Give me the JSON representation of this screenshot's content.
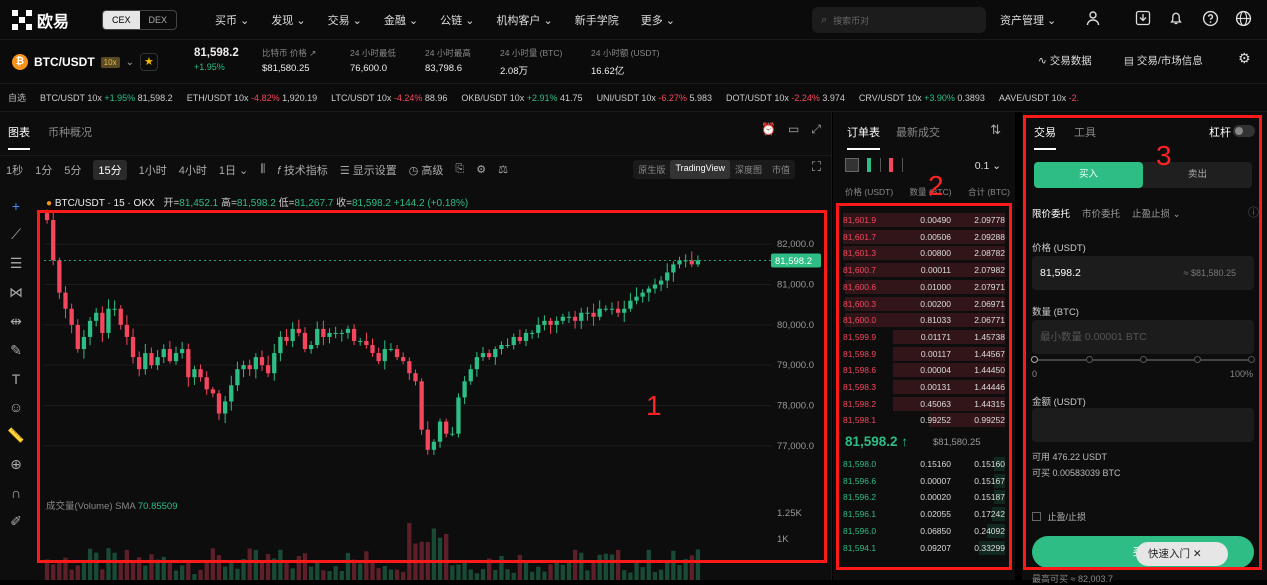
{
  "brand": {
    "name": "欧易"
  },
  "env_switch": {
    "cex": "CEX",
    "dex": "DEX"
  },
  "nav": [
    "买币 ⌄",
    "发现 ⌄",
    "交易 ⌄",
    "金融 ⌄",
    "公链 ⌄",
    "机构客户 ⌄",
    "新手学院",
    "更多 ⌄"
  ],
  "search": {
    "placeholder": "搜索币对"
  },
  "assets_label": "资产管理 ⌄",
  "ticker": {
    "pair": "BTC/USDT",
    "leverage": "10x",
    "last": "81,598.2",
    "change": "+1.95%",
    "index_label": "比特币 价格 ↗",
    "index_value": "$81,580.25",
    "low_label": "24 小时最低",
    "low_value": "76,600.0",
    "high_label": "24 小时最高",
    "high_value": "83,798.6",
    "vol_label": "24 小时量 (BTC)",
    "vol_value": "2.08万",
    "amt_label": "24 小时额 (USDT)",
    "amt_value": "16.62亿"
  },
  "right_tools": {
    "data": "交易数据",
    "info": "交易/市场信息"
  },
  "favorites": {
    "label": "自选",
    "items": [
      {
        "pair": "BTC/USDT 10x",
        "chg": "+1.95%",
        "price": "81,598.2",
        "dir": "up"
      },
      {
        "pair": "ETH/USDT 10x",
        "chg": "-4.82%",
        "price": "1,920.19",
        "dir": "dn"
      },
      {
        "pair": "LTC/USDT 10x",
        "chg": "-4.24%",
        "price": "88.96",
        "dir": "dn"
      },
      {
        "pair": "OKB/USDT 10x",
        "chg": "+2.91%",
        "price": "41.75",
        "dir": "up"
      },
      {
        "pair": "UNI/USDT 10x",
        "chg": "-6.27%",
        "price": "5.983",
        "dir": "dn"
      },
      {
        "pair": "DOT/USDT 10x",
        "chg": "-2.24%",
        "price": "3.974",
        "dir": "dn"
      },
      {
        "pair": "CRV/USDT 10x",
        "chg": "+3.90%",
        "price": "0.3893",
        "dir": "up"
      },
      {
        "pair": "AAVE/USDT 10x",
        "chg": "-2.",
        "price": "",
        "dir": "dn"
      }
    ]
  },
  "chart": {
    "tabs": [
      "图表",
      "币种概况"
    ],
    "intervals": [
      "1秒",
      "1分",
      "5分",
      "15分",
      "1小时",
      "4小时",
      "1日 ⌄"
    ],
    "active_interval": "15分",
    "indicators": "技术指标",
    "display": "显示设置",
    "advanced": "高级",
    "views": [
      "原生版",
      "TradingView",
      "深度图",
      "市值"
    ],
    "active_view": "TradingView",
    "ohlc_title": "BTC/USDT · 15 · OKX",
    "o_label": "开=",
    "o": "81,452.1",
    "h_label": "高=",
    "h": "81,598.2",
    "l_label": "低=",
    "l": "81,267.7",
    "c_label": "收=",
    "c": "81,598.2",
    "chg": "+144.2 (+0.18%)",
    "volume_label": "成交量(Volume)",
    "sma_label": "SMA",
    "sma_value": "70.85509",
    "price_ticks": [
      "82,000.0",
      "81,000.0",
      "80,000.0",
      "79,000.0",
      "78,000.0",
      "77,000.0"
    ],
    "current_price_tag": "81,598.2",
    "vol_ticks": [
      "1.25K",
      "1K"
    ]
  },
  "chart_data": {
    "type": "candlestick",
    "title": "BTC/USDT · 15 · OKX",
    "ylim": [
      76300,
      82800
    ],
    "closes": [
      82600,
      81600,
      80800,
      80400,
      80000,
      79400,
      79700,
      80100,
      80300,
      79800,
      80400,
      80400,
      80000,
      79700,
      79200,
      78900,
      79300,
      79000,
      79200,
      79400,
      79100,
      79300,
      79400,
      78700,
      78900,
      78700,
      78400,
      78300,
      77800,
      78100,
      78500,
      78900,
      79000,
      78900,
      79200,
      79000,
      78800,
      79300,
      79700,
      79600,
      79900,
      79800,
      79400,
      79500,
      79900,
      79700,
      79800,
      79800,
      79800,
      79900,
      79600,
      79600,
      79500,
      79300,
      79100,
      79400,
      79400,
      79200,
      79100,
      78800,
      78600,
      77400,
      76900,
      77100,
      77600,
      77300,
      77300,
      78200,
      78600,
      78900,
      79200,
      79300,
      79200,
      79400,
      79500,
      79500,
      79700,
      79600,
      79800,
      79800,
      80000,
      80100,
      80000,
      80100,
      80200,
      80200,
      80100,
      80300,
      80300,
      80200,
      80400,
      80400,
      80400,
      80300,
      80400,
      80600,
      80700,
      80800,
      80900,
      81000,
      81100,
      81300,
      81500,
      81600,
      81600,
      81500,
      81600
    ],
    "volume_sma": 70.85509
  },
  "orderbook": {
    "tabs": [
      "订单表",
      "最新成交"
    ],
    "step": "0.1 ⌄",
    "head_price": "价格 (USDT)",
    "head_qty": "数量 (BTC)",
    "head_total": "合计 (BTC)",
    "asks": [
      {
        "p": "81,601.9",
        "q": "0.00490",
        "t": "2.09778",
        "d": 1.0
      },
      {
        "p": "81,601.7",
        "q": "0.00506",
        "t": "2.09288",
        "d": 1.0
      },
      {
        "p": "81,601.3",
        "q": "0.00800",
        "t": "2.08782",
        "d": 1.0
      },
      {
        "p": "81,600.7",
        "q": "0.00011",
        "t": "2.07982",
        "d": 0.99
      },
      {
        "p": "81,600.6",
        "q": "0.01000",
        "t": "2.07971",
        "d": 0.99
      },
      {
        "p": "81,600.3",
        "q": "0.00200",
        "t": "2.06971",
        "d": 0.99
      },
      {
        "p": "81,600.0",
        "q": "0.81033",
        "t": "2.06771",
        "d": 0.99
      },
      {
        "p": "81,599.9",
        "q": "0.01171",
        "t": "1.45738",
        "d": 0.69
      },
      {
        "p": "81,598.9",
        "q": "0.00117",
        "t": "1.44567",
        "d": 0.69
      },
      {
        "p": "81,598.6",
        "q": "0.00004",
        "t": "1.44450",
        "d": 0.69
      },
      {
        "p": "81,598.3",
        "q": "0.00131",
        "t": "1.44446",
        "d": 0.69
      },
      {
        "p": "81,598.2",
        "q": "0.45063",
        "t": "1.44315",
        "d": 0.69
      },
      {
        "p": "81,598.1",
        "q": "0.99252",
        "t": "0.99252",
        "d": 0.47
      }
    ],
    "mid_price": "81,598.2 ↑",
    "mid_ref": "$81,580.25",
    "bids": [
      {
        "p": "81,598.0",
        "q": "0.15160",
        "t": "0.15160",
        "d": 0.07
      },
      {
        "p": "81,596.6",
        "q": "0.00007",
        "t": "0.15167",
        "d": 0.07
      },
      {
        "p": "81,596.2",
        "q": "0.00020",
        "t": "0.15187",
        "d": 0.07
      },
      {
        "p": "81,596.1",
        "q": "0.02055",
        "t": "0.17242",
        "d": 0.08
      },
      {
        "p": "81,596.0",
        "q": "0.06850",
        "t": "0.24092",
        "d": 0.11
      },
      {
        "p": "81,594.1",
        "q": "0.09207",
        "t": "0.33299",
        "d": 0.16
      }
    ]
  },
  "trade": {
    "tabs": [
      "交易",
      "工具"
    ],
    "leverage_label": "杠杆",
    "buy": "买入",
    "sell": "卖出",
    "order_types": [
      "限价委托",
      "市价委托",
      "止盈止损 ⌄"
    ],
    "price_label": "价格 (USDT)",
    "price_value": "81,598.2",
    "price_ref": "≈ $81,580.25",
    "qty_label": "数量 (BTC)",
    "qty_placeholder": "最小数量 0.00001 BTC",
    "slider_min": "0",
    "slider_max": "100%",
    "amount_label": "金额 (USDT)",
    "available_usdt": "可用 476.22 USDT",
    "available_btc": "可买 0.00583039 BTC",
    "tpsl": "止盈/止损",
    "submit": "买入",
    "max_text": "最高可买 ≈ 82,003.7"
  },
  "quick_entry": "快速入门  ✕",
  "annotations": [
    "1",
    "2",
    "3"
  ]
}
